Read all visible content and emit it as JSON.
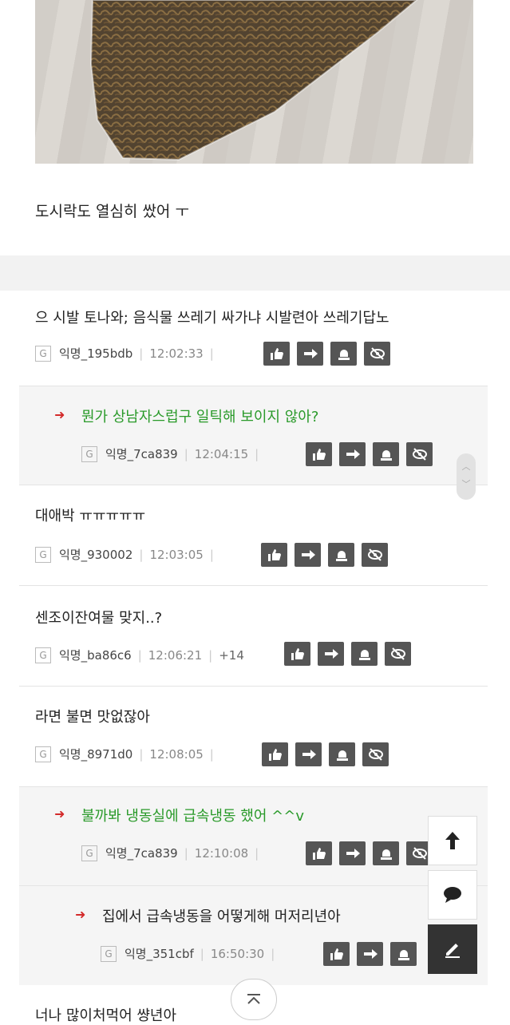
{
  "post": {
    "text": "도시락도 열심히 쌌어 ㅜ"
  },
  "comments": [
    {
      "text": "으 시발 토나와; 음식물 쓰레기 싸가냐 시발련아 쓰레기답노",
      "badge": "G",
      "user": "익명_195bdb",
      "time": "12:02:33",
      "extra": ""
    },
    {
      "text": "뭔가 상남자스럽구 일틱해 보이지 않아?",
      "badge": "G",
      "user": "익명_7ca839",
      "time": "12:04:15",
      "extra": ""
    },
    {
      "text": "대애박 ㅠㅠㅠㅠㅠ",
      "badge": "G",
      "user": "익명_930002",
      "time": "12:03:05",
      "extra": ""
    },
    {
      "text": "센조이잔여물 맞지..?",
      "badge": "G",
      "user": "익명_ba86c6",
      "time": "12:06:21",
      "extra": "+14"
    },
    {
      "text": "라면 불면 맛없잖아",
      "badge": "G",
      "user": "익명_8971d0",
      "time": "12:08:05",
      "extra": ""
    },
    {
      "text": "불까봐 냉동실에 급속냉동 했어 ^^v",
      "badge": "G",
      "user": "익명_7ca839",
      "time": "12:10:08",
      "extra": ""
    },
    {
      "text": "집에서 급속냉동을 어떻게해 머저리년아",
      "badge": "G",
      "user": "익명_351cbf",
      "time": "16:50:30",
      "extra": ""
    }
  ],
  "partial_comment": {
    "text": "너나 많이처먹어 썅년아"
  },
  "icons": {
    "like": "thumbs-up-icon",
    "reply": "arrow-right-icon",
    "report": "siren-icon",
    "hide": "eye-slash-icon",
    "scroll_top": "arrow-up-icon",
    "comment": "speech-bubble-icon",
    "write": "pencil-icon",
    "page_top": "chevron-double-up-icon"
  },
  "colors": {
    "reply_text": "#2a9a2a",
    "reply_arrow": "#d32a2a",
    "action_bg": "#555555"
  }
}
